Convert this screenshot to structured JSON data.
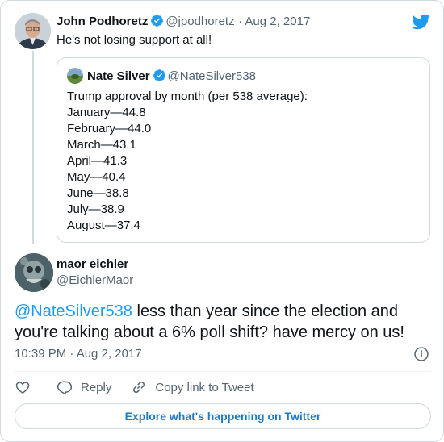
{
  "parent_tweet": {
    "name": "John Podhoretz",
    "handle": "@jpodhoretz",
    "date": "· Aug 2, 2017",
    "text": "He's not losing support at all!"
  },
  "quoted_tweet": {
    "name": "Nate Silver",
    "handle": "@NateSilver538",
    "lines": [
      "Trump approval by month (per 538 average):",
      "January—44.8",
      "February—44.0",
      "March—43.1",
      "April—41.3",
      "May—40.4",
      "June—38.8",
      "July—38.9",
      "August—37.4"
    ]
  },
  "main_tweet": {
    "name": "maor eichler",
    "handle": "@EichlerMaor",
    "mention": "@NateSilver538",
    "text": " less than year since the election and you're talking about a 6% poll shift? have mercy on us!",
    "timestamp": "10:39 PM · Aug 2, 2017"
  },
  "actions": {
    "reply_label": "Reply",
    "copy_label": "Copy link to Tweet"
  },
  "explore_label": "Explore what's happening on Twitter",
  "colors": {
    "accent": "#1d9bf0",
    "verified": "#1d9bf0",
    "secondary_text": "#536471",
    "border": "#cfd9de"
  },
  "icons": [
    "twitter-logo-icon",
    "verified-badge-icon",
    "info-icon",
    "heart-icon",
    "reply-icon",
    "link-icon"
  ]
}
